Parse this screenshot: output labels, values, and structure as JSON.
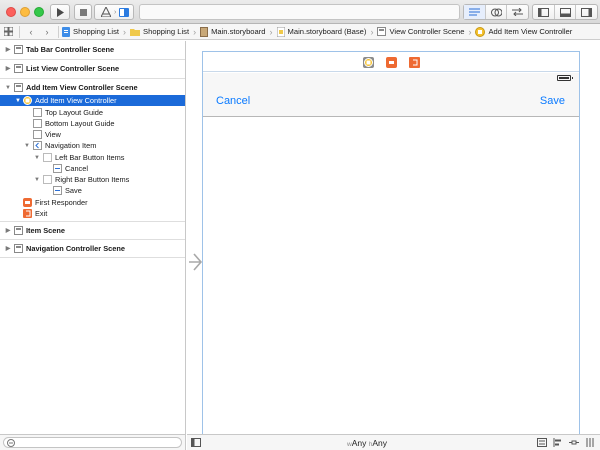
{
  "toolbar": {
    "run_icon": "play-icon",
    "stop_icon": "stop-icon",
    "scheme_icon": "app-target-icon",
    "activity_text": "",
    "editor_modes": [
      "standard-editor-icon",
      "assistant-editor-icon",
      "version-editor-icon"
    ],
    "view_toggles": [
      "left-panel-icon",
      "bottom-panel-icon",
      "right-panel-icon"
    ]
  },
  "jumpbar": {
    "crumbs": [
      {
        "label": "Shopping List",
        "icon": "project-icon"
      },
      {
        "label": "Shopping List",
        "icon": "folder-icon"
      },
      {
        "label": "Main.storyboard",
        "icon": "storyboard-icon"
      },
      {
        "label": "Main.storyboard (Base)",
        "icon": "storyboard-base-icon"
      },
      {
        "label": "View Controller Scene",
        "icon": "scene-icon"
      },
      {
        "label": "Add Item View Controller",
        "icon": "view-controller-icon"
      }
    ]
  },
  "outline": {
    "rows": [
      {
        "label": "Tab Bar Controller Scene",
        "disclosure": "▶",
        "icon": "scene-icon",
        "bold": true,
        "indent": 0
      },
      {
        "label": "List View Controller Scene",
        "disclosure": "▶",
        "icon": "scene-icon",
        "bold": true,
        "indent": 0
      },
      {
        "label": "Add Item View Controller Scene",
        "disclosure": "▼",
        "icon": "scene-icon",
        "bold": true,
        "indent": 0
      },
      {
        "label": "Add Item View Controller",
        "disclosure": "▼",
        "icon": "view-controller-icon",
        "bold": false,
        "indent": 1,
        "selected": true
      },
      {
        "label": "Top Layout Guide",
        "disclosure": "",
        "icon": "layout-guide-icon",
        "bold": false,
        "indent": 2
      },
      {
        "label": "Bottom Layout Guide",
        "disclosure": "",
        "icon": "layout-guide-icon",
        "bold": false,
        "indent": 2
      },
      {
        "label": "View",
        "disclosure": "",
        "icon": "view-icon",
        "bold": false,
        "indent": 2
      },
      {
        "label": "Navigation Item",
        "disclosure": "▼",
        "icon": "navigation-item-icon",
        "bold": false,
        "indent": 2
      },
      {
        "label": "Left Bar Button Items",
        "disclosure": "▼",
        "icon": "bar-items-icon",
        "bold": false,
        "indent": 3
      },
      {
        "label": "Cancel",
        "disclosure": "",
        "icon": "bar-button-icon",
        "bold": false,
        "indent": 4
      },
      {
        "label": "Right Bar Button Items",
        "disclosure": "▼",
        "icon": "bar-items-icon",
        "bold": false,
        "indent": 3
      },
      {
        "label": "Save",
        "disclosure": "",
        "icon": "bar-button-icon",
        "bold": false,
        "indent": 4
      },
      {
        "label": "First Responder",
        "disclosure": "",
        "icon": "first-responder-icon",
        "bold": false,
        "indent": 1
      },
      {
        "label": "Exit",
        "disclosure": "",
        "icon": "exit-icon",
        "bold": false,
        "indent": 1
      },
      {
        "label": "Item Scene",
        "disclosure": "▶",
        "icon": "scene-icon",
        "bold": true,
        "indent": 0
      },
      {
        "label": "Navigation Controller Scene",
        "disclosure": "▶",
        "icon": "scene-icon",
        "bold": true,
        "indent": 0
      }
    ]
  },
  "scene": {
    "navbar": {
      "left_button": "Cancel",
      "right_button": "Save"
    },
    "dock_icons": [
      "view-controller-icon",
      "first-responder-icon",
      "exit-icon"
    ]
  },
  "footer": {
    "size_class": {
      "w_prefix": "w",
      "w_value": "Any",
      "h_prefix": "h",
      "h_value": "Any"
    }
  },
  "colors": {
    "selection": "#1b6ad9",
    "ios_tint": "#0a7aff",
    "scene_border": "#9ec2e8",
    "vc_yellow": "#f5c12e",
    "orange": "#ee6a32"
  }
}
